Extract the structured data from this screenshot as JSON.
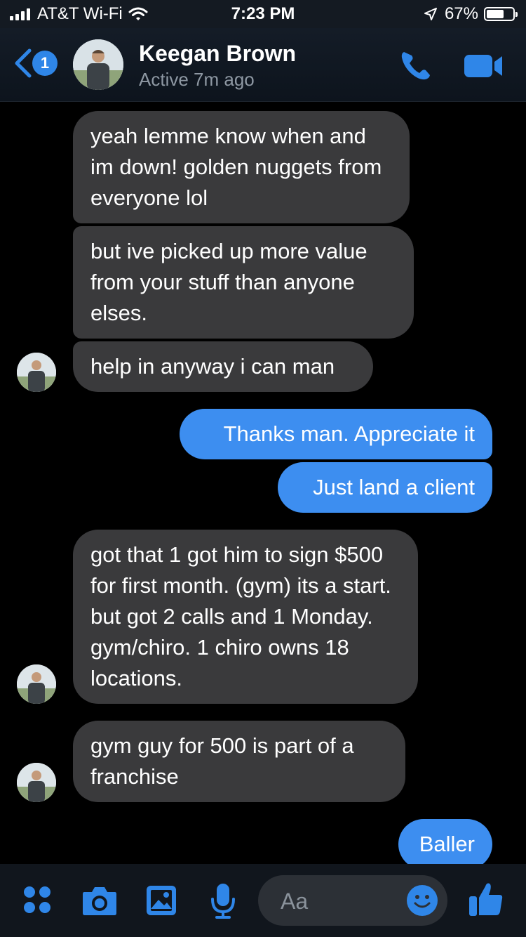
{
  "status_bar": {
    "carrier": "AT&T Wi-Fi",
    "time": "7:23 PM",
    "battery_percent_text": "67%",
    "battery_level": 0.67,
    "icons": [
      "cellular-signal-icon",
      "wifi-icon",
      "location-arrow-icon",
      "battery-icon"
    ]
  },
  "header": {
    "back_badge": "1",
    "contact_name": "Keegan Brown",
    "presence": "Active 7m ago",
    "actions": [
      "phone-icon",
      "video-camera-icon"
    ]
  },
  "messages": [
    {
      "from": "them",
      "text": "yeah lemme know when and im down! golden nuggets from everyone lol"
    },
    {
      "from": "them",
      "text": "but ive picked up more value from your stuff than anyone elses."
    },
    {
      "from": "them",
      "text": "help in anyway i can man"
    },
    {
      "from": "me",
      "text": "Thanks man. Appreciate it"
    },
    {
      "from": "me",
      "text": "Just land a client"
    },
    {
      "from": "them",
      "text": "got that 1 got him to sign $500 for first month. (gym) its a start. but got 2 calls and 1 Monday. gym/chiro. 1 chiro owns 18 locations."
    },
    {
      "from": "them",
      "text": "gym guy for 500 is part of a franchise"
    },
    {
      "from": "me",
      "text": "Baller"
    }
  ],
  "composer": {
    "placeholder": "Aa",
    "tools": [
      "apps-grid-icon",
      "camera-icon",
      "photo-gallery-icon",
      "microphone-icon"
    ],
    "emoji_icon": "smiley-icon",
    "like_icon": "thumbs-up-icon"
  },
  "colors": {
    "outgoing_bubble": "#3d8ef0",
    "incoming_bubble": "#3a3a3c",
    "accent": "#2f86e8",
    "background": "#000000"
  }
}
